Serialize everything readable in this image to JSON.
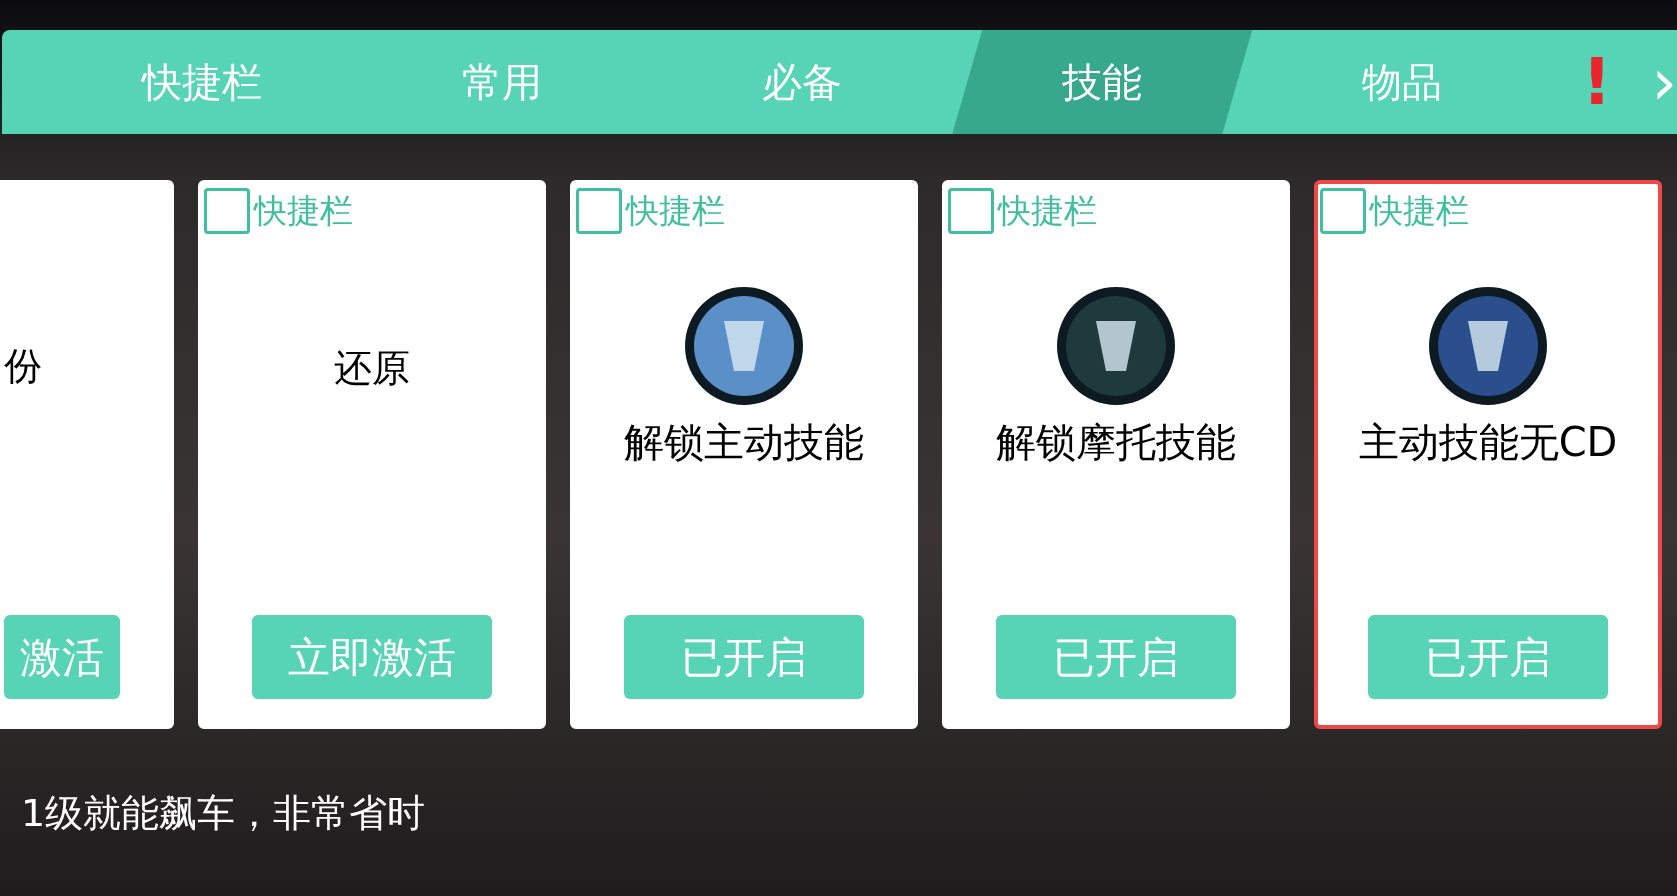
{
  "tabs": [
    {
      "label": "快捷栏",
      "selected": false
    },
    {
      "label": "常用",
      "selected": false
    },
    {
      "label": "必备",
      "selected": false
    },
    {
      "label": "技能",
      "selected": true
    },
    {
      "label": "物品",
      "selected": false
    }
  ],
  "alert_mark": "!",
  "next_arrow": "›",
  "cards": [
    {
      "kind": "plain",
      "title": "份",
      "button": "激活",
      "selected": false
    },
    {
      "kind": "plain",
      "title": "还原",
      "button": "立即激活",
      "shortcut_label": "快捷栏",
      "checked": false,
      "selected": false
    },
    {
      "kind": "skill",
      "title": "解锁主动技能",
      "button": "已开启",
      "shortcut_label": "快捷栏",
      "checked": false,
      "selected": false
    },
    {
      "kind": "skill",
      "title": "解锁摩托技能",
      "button": "已开启",
      "shortcut_label": "快捷栏",
      "checked": false,
      "selected": false
    },
    {
      "kind": "skill",
      "title": "主动技能无CD",
      "button": "已开启",
      "shortcut_label": "快捷栏",
      "checked": false,
      "selected": true
    }
  ],
  "description": "1级就能飙车，非常省时"
}
